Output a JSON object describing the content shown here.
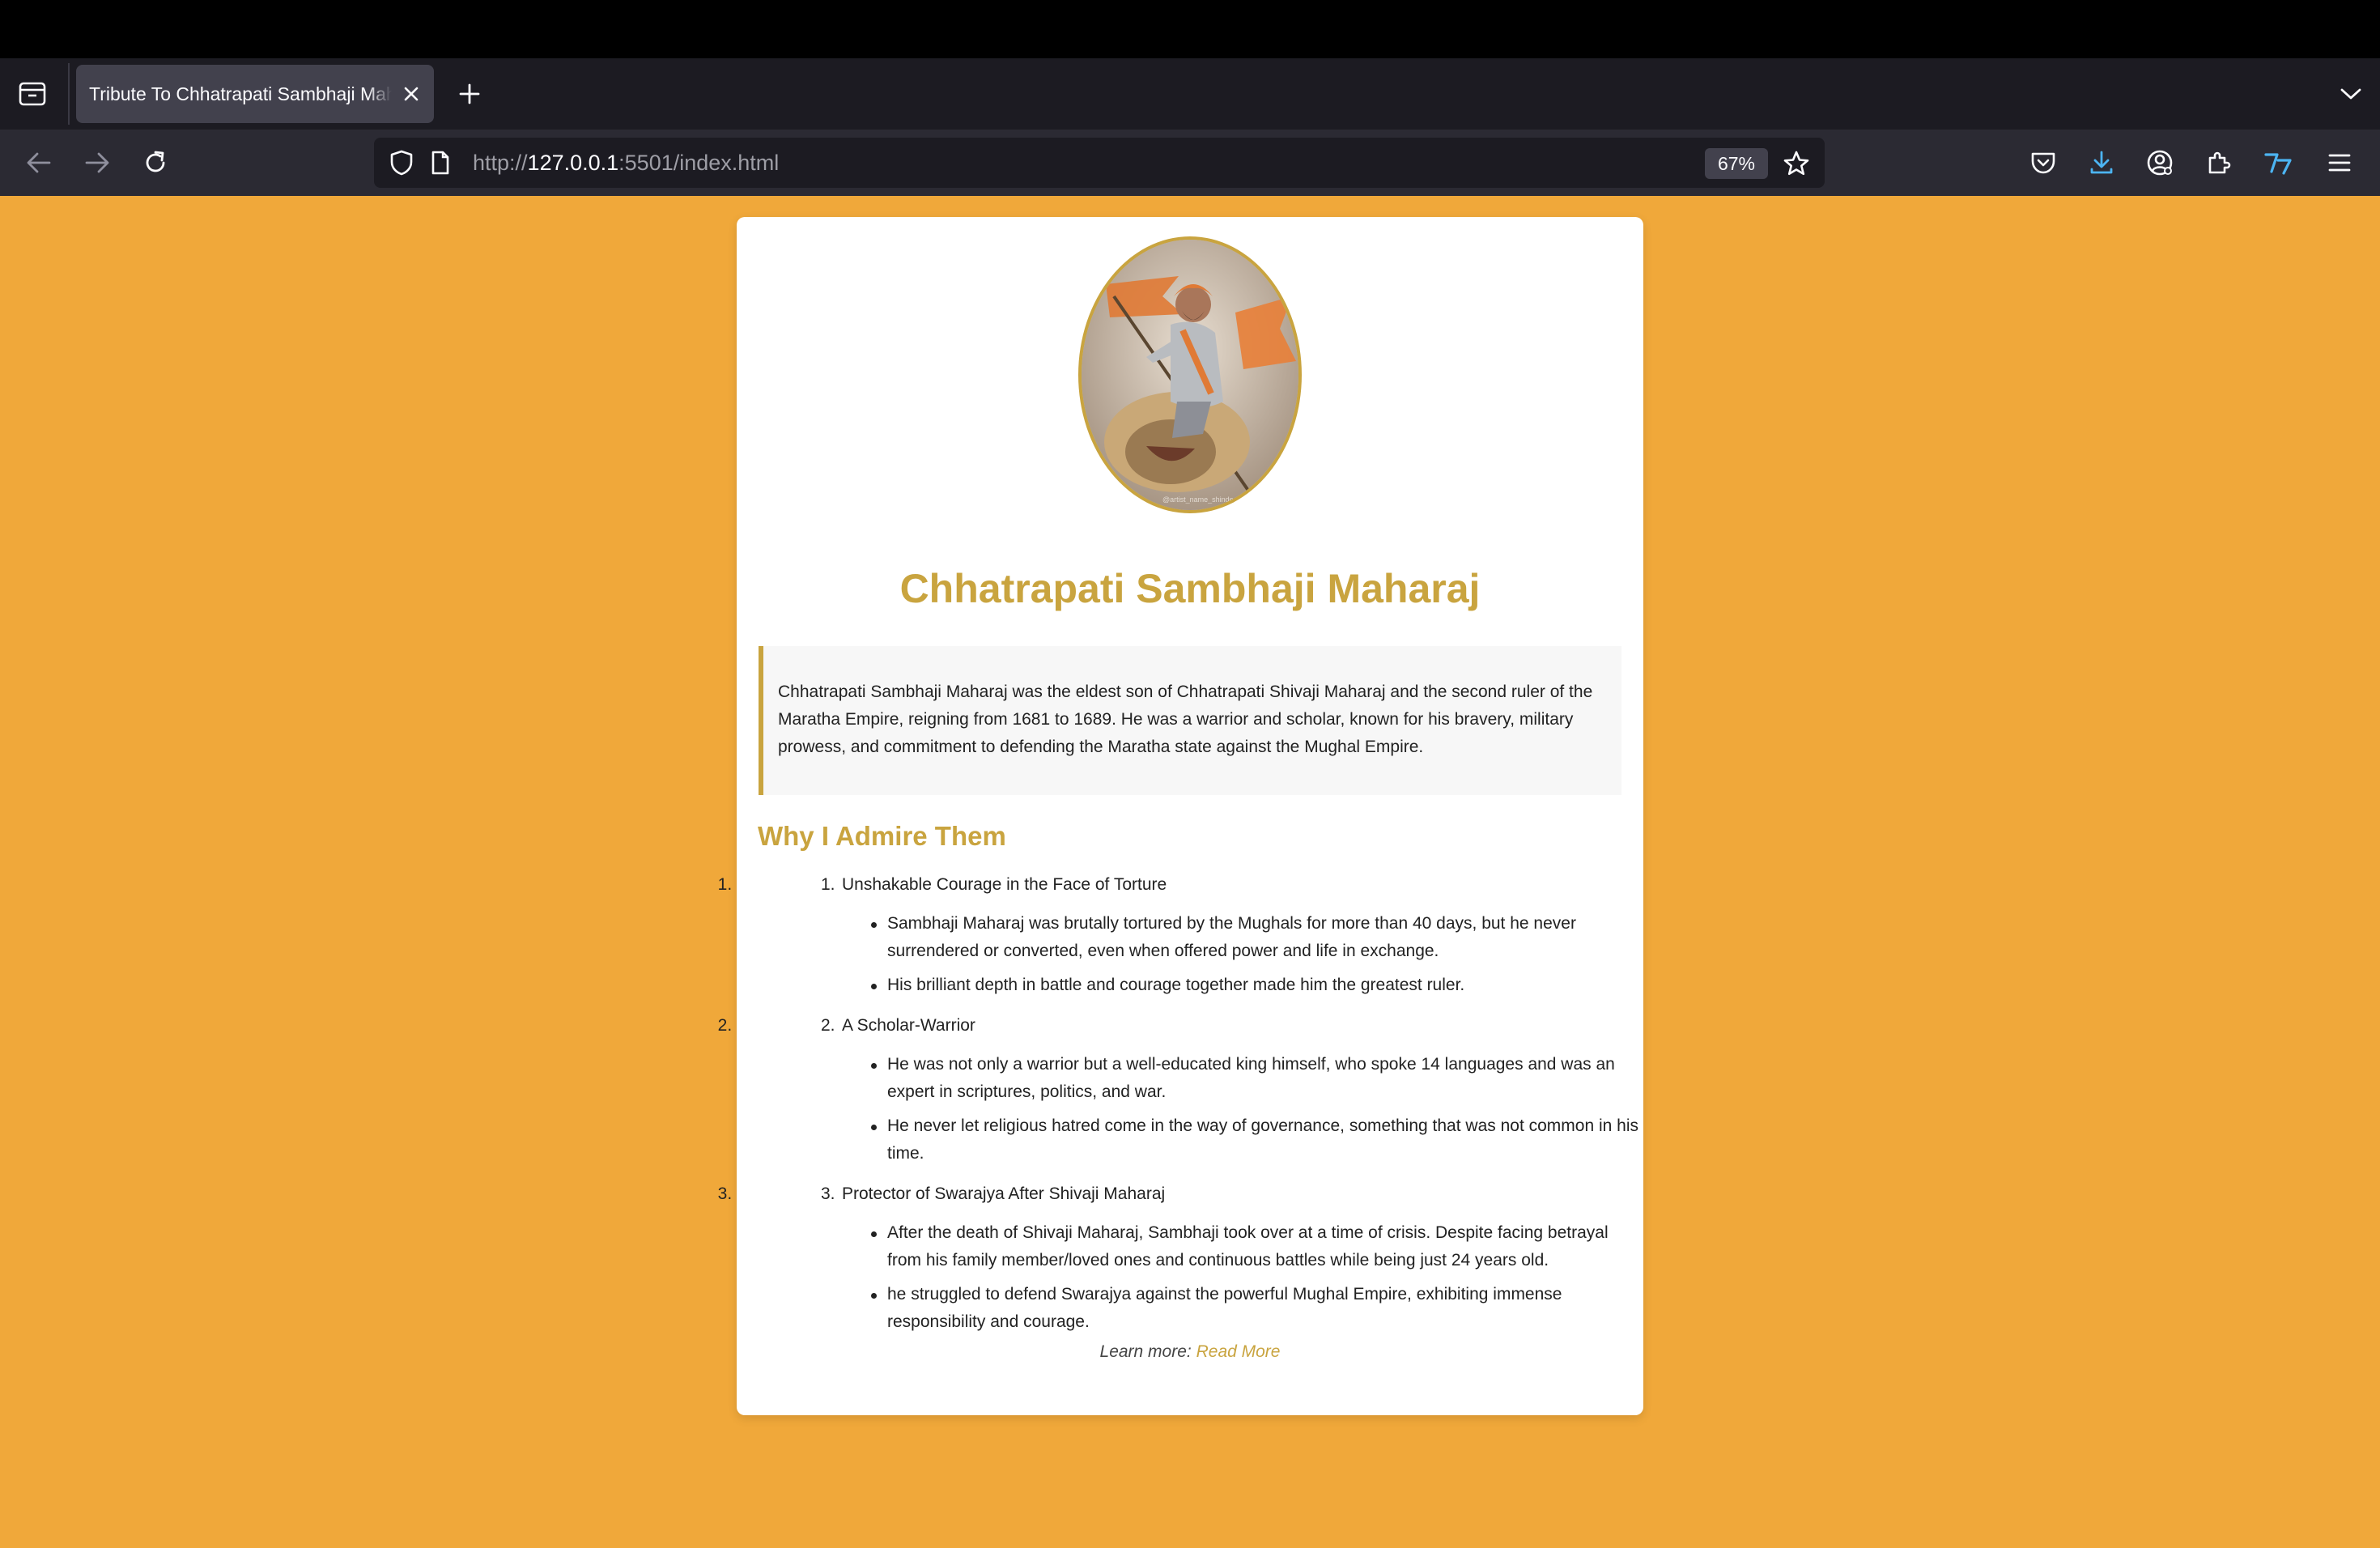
{
  "browser": {
    "tab_title": "Tribute To Chhatrapati Sambhaji Maharaj",
    "url_prefix": "http://",
    "url_host": "127.0.0.1",
    "url_rest": ":5501/index.html",
    "zoom": "67%"
  },
  "page": {
    "portrait_watermark": "@artist_name_shinde",
    "title": "Chhatrapati Sambhaji Maharaj",
    "intro": "Chhatrapati Sambhaji Maharaj was the eldest son of Chhatrapati Shivaji Maharaj and the second ruler of the Maratha Empire, reigning from 1681 to 1689. He was a warrior and scholar, known for his bravery, military prowess, and commitment to defending the Maratha state against the Mughal Empire.",
    "section_title": "Why I Admire Them",
    "reasons": [
      {
        "number": "1.",
        "title": "Unshakable Courage in the Face of Torture",
        "points": [
          "Sambhaji Maharaj was brutally tortured by the Mughals for more than 40 days, but he never surrendered or converted, even when offered power and life in exchange.",
          "His brilliant depth in battle and courage together made him the greatest ruler."
        ]
      },
      {
        "number": "2.",
        "title": "A Scholar-Warrior",
        "points": [
          "He was not only a warrior but a well-educated king himself, who spoke 14 languages and was an expert in scriptures, politics, and war.",
          "He never let religious hatred come in the way of governance, something that was not common in his time."
        ]
      },
      {
        "number": "3.",
        "title": "Protector of Swarajya After Shivaji Maharaj",
        "points": [
          "After the death of Shivaji Maharaj, Sambhaji took over at a time of crisis. Despite facing betrayal from his family member/loved ones and continuous battles while being just 24 years old.",
          "he struggled to defend Swarajya against the powerful Mughal Empire, exhibiting immense responsibility and courage."
        ]
      }
    ],
    "learn_more_label": "Learn more:",
    "read_more_link": "Read More"
  },
  "colors": {
    "background": "#f0a83a",
    "accent": "#c9a43f",
    "card": "#ffffff"
  }
}
